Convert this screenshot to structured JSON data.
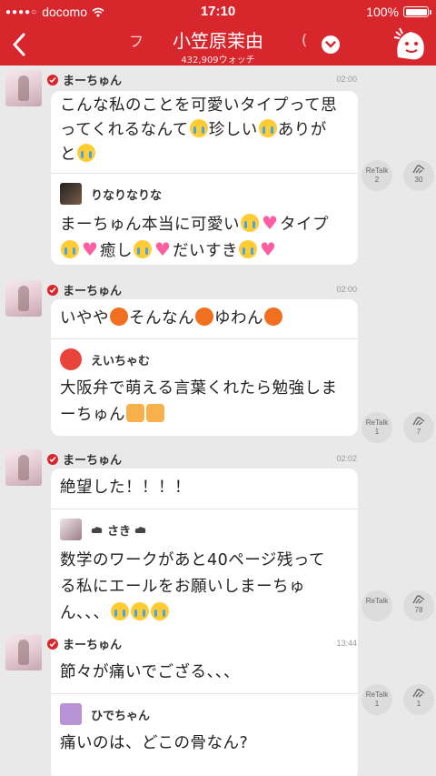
{
  "status_bar": {
    "carrier": "docomo",
    "time": "17:10",
    "battery": "100%"
  },
  "header": {
    "title": "小笠原茉由",
    "subtitle": "432,909ウォッチ",
    "left_fragment": "フ",
    "right_fragment": "("
  },
  "posts": [
    {
      "author": "まーちゅん",
      "time": "02:00",
      "message_lines": [
        "こんな私のことを可愛いタイプって思",
        "ってくれるなんて",
        "珍しい",
        "ありが",
        "と"
      ],
      "reply": {
        "author": "りなりなりな",
        "lines": [
          "まーちゅん本当に可愛い",
          "タイプ",
          "癒し",
          "だいすき"
        ]
      },
      "retalk_label": "ReTalk",
      "retalk_count": "2",
      "like_count": "30"
    },
    {
      "author": "まーちゅん",
      "time": "02:00",
      "message_lines": [
        "いやや",
        "そんなん",
        "ゆわん"
      ],
      "reply": {
        "author": "えいちゃむ",
        "lines": [
          "大阪弁で萌える言葉くれたら勉強しま",
          "ーちゅん"
        ]
      },
      "retalk_label": "ReTalk",
      "retalk_count": "1",
      "like_count": "7"
    },
    {
      "author": "まーちゅん",
      "time": "02:02",
      "message_lines": [
        "絶望した！！！！"
      ],
      "reply": {
        "author": "さき",
        "lines": [
          "数学のワークがあと40ページ残って",
          "る私にエールをお願いしまーちゅ",
          "ん、、、"
        ]
      },
      "retalk_label": "ReTalk",
      "retalk_count": "",
      "like_count": "78"
    },
    {
      "author": "まーちゅん",
      "time": "13:44",
      "message_lines": [
        "節々が痛いでござる、、、"
      ],
      "reply": {
        "author": "ひでちゃん",
        "lines": [
          "痛いのは、どこの骨なん?"
        ]
      },
      "retalk_label": "ReTalk",
      "retalk_count": "1",
      "like_count": "1"
    }
  ],
  "colors": {
    "brand": "#d8262d",
    "background": "#e9e9e9",
    "bubble": "#ffffff"
  },
  "icons": [
    "back-arrow",
    "chevron-down",
    "mascot",
    "verified-check",
    "retalk",
    "like-hand",
    "emoji"
  ]
}
